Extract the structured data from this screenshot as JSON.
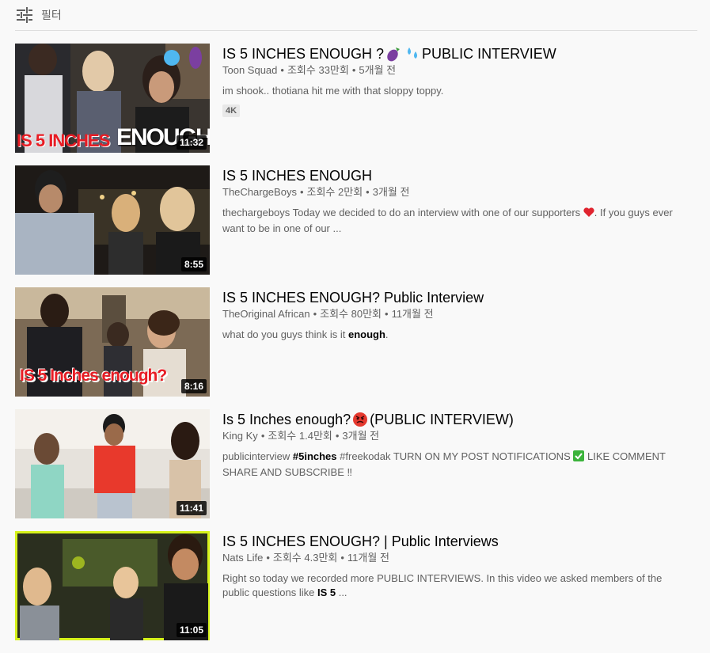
{
  "filter": {
    "label": "필터",
    "icon": "tune-icon"
  },
  "videos": [
    {
      "title": "IS 5 INCHES ENOUGH ?",
      "title_suffix": "PUBLIC INTERVIEW",
      "channel": "Toon Squad",
      "views": "조회수 33만회",
      "age": "5개월 전",
      "description": "im shook.. thotiana hit me with that sloppy toppy.",
      "badge": "4K",
      "duration": "11:32",
      "thumb_text_a": "IS 5 INCHES",
      "thumb_text_b": "ENOUGH"
    },
    {
      "title": "IS 5 INCHES ENOUGH",
      "channel": "TheChargeBoys",
      "views": "조회수 2만회",
      "age": "3개월 전",
      "description_a": "thechargeboys Today we decided to do an interview with one of our supporters",
      "description_b": ". If you guys ever want to be in one of our ...",
      "duration": "8:55"
    },
    {
      "title": "IS 5 INCHES ENOUGH? Public Interview",
      "channel": "TheOriginal African",
      "views": "조회수 80만회",
      "age": "11개월 전",
      "description_a": "what do you guys think is it ",
      "description_bold": "enough",
      "description_b": ".",
      "duration": "8:16",
      "thumb_text": "IS 5 Inches enough?"
    },
    {
      "title": "Is 5 Inches enough?",
      "title_suffix": "(PUBLIC INTERVIEW)",
      "channel": "King Ky",
      "views": "조회수 1.4만회",
      "age": "3개월 전",
      "description_a": "publicinterview ",
      "description_bold": "#5inches",
      "description_b": " #freekodak TURN ON MY POST NOTIFICATIONS",
      "description_c": " LIKE COMMENT SHARE AND SUBSCRIBE ‼",
      "duration": "11:41"
    },
    {
      "title": "IS 5 INCHES ENOUGH? | Public Interviews",
      "channel": "Nats Life",
      "views": "조회수 4.3만회",
      "age": "11개월 전",
      "description_a": "Right so today we recorded more PUBLIC INTERVIEWS. In this video we asked members of the public questions like ",
      "description_bold": "IS 5",
      "description_b": " ...",
      "duration": "11:05"
    }
  ],
  "separator": "•"
}
